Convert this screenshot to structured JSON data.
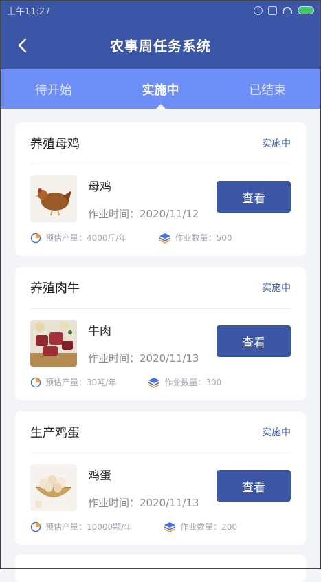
{
  "status_bar": {
    "time": "上午11:27"
  },
  "header": {
    "title": "农事周任务系统"
  },
  "tabs": [
    {
      "label": "待开始"
    },
    {
      "label": "实施中"
    },
    {
      "label": "已结束"
    }
  ],
  "active_tab": "实施中",
  "colors": {
    "header_bg": "#3b55a7",
    "tab_bg": "#6d8ef6",
    "button": "#3c55a5",
    "accent": "#3b55a7"
  },
  "tasks": [
    {
      "title": "养殖母鸡",
      "status": "实施中",
      "product": "母鸡",
      "time": "作业时间：2020/11/12",
      "button": "查看",
      "estimate": "预估产量：4000斤/年",
      "quantity": "作业数量：500",
      "image": "chicken"
    },
    {
      "title": "养殖肉牛",
      "status": "实施中",
      "product": "牛肉",
      "time": "作业时间：2020/11/13",
      "button": "查看",
      "estimate": "预估产量：30吨/年",
      "quantity": "作业数量：300",
      "image": "beef"
    },
    {
      "title": "生产鸡蛋",
      "status": "实施中",
      "product": "鸡蛋",
      "time": "作业时间：2020/11/13",
      "button": "查看",
      "estimate": "预估产量：10000颗/年",
      "quantity": "作业数量：200",
      "image": "eggs"
    }
  ]
}
